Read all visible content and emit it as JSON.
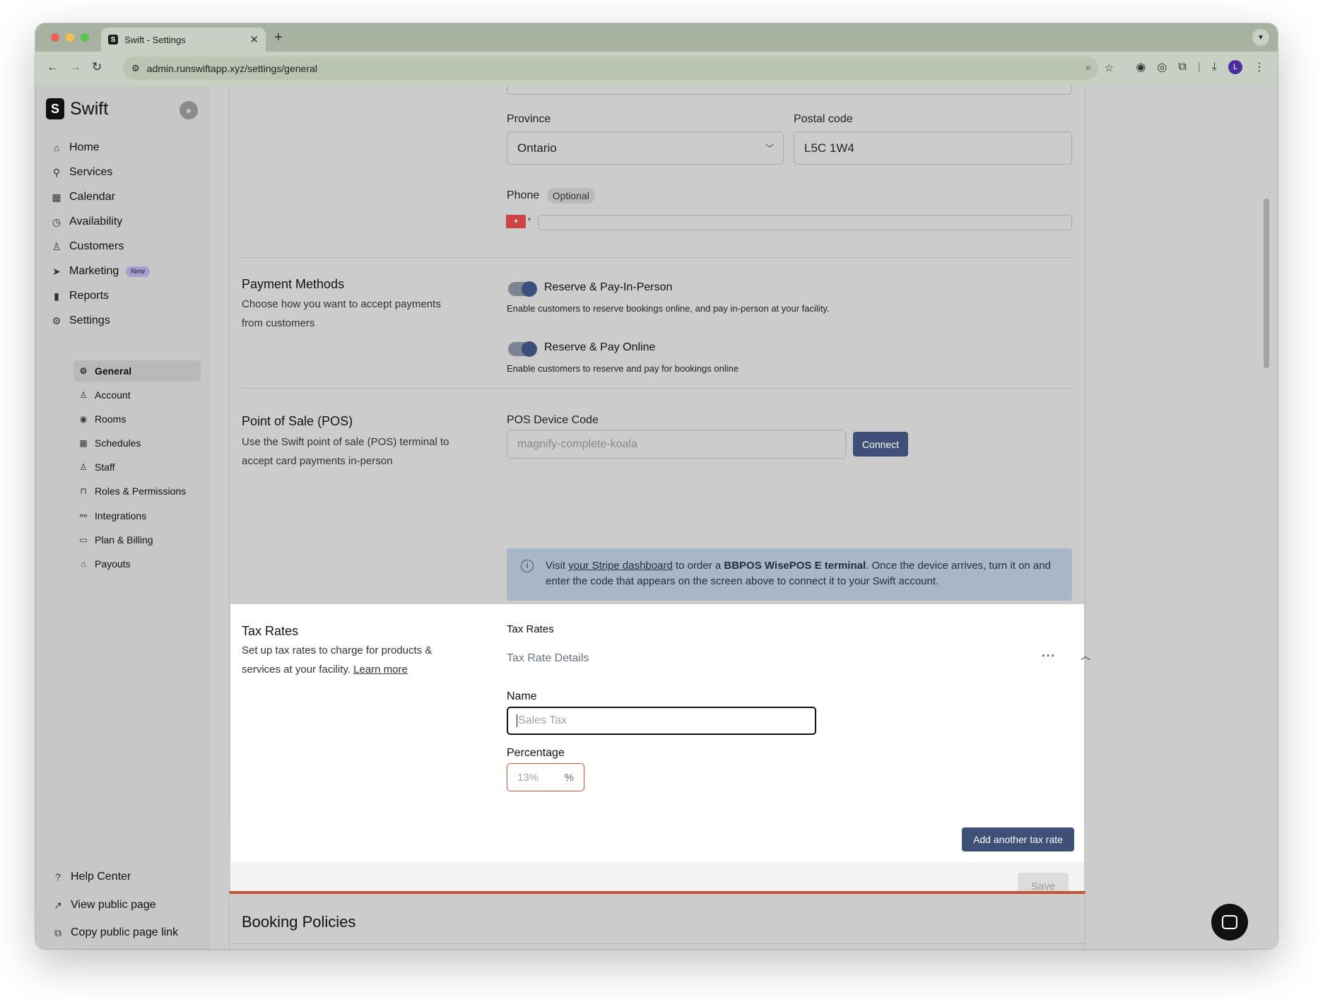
{
  "browser": {
    "tab_title": "Swift - Settings",
    "favicon": "S",
    "url": "admin.runswiftapp.xyz/settings/general",
    "profile_initial": "L"
  },
  "sidebar": {
    "brand": "Swift",
    "logo_letter": "S",
    "nav": [
      {
        "label": "Home",
        "icon": "home-icon"
      },
      {
        "label": "Services",
        "icon": "link-icon"
      },
      {
        "label": "Calendar",
        "icon": "calendar-icon"
      },
      {
        "label": "Availability",
        "icon": "clock-icon"
      },
      {
        "label": "Customers",
        "icon": "user-icon"
      },
      {
        "label": "Marketing",
        "icon": "send-icon",
        "badge": "New"
      },
      {
        "label": "Reports",
        "icon": "bar-chart-icon"
      },
      {
        "label": "Settings",
        "icon": "gear-icon"
      }
    ],
    "settings_sub": [
      {
        "label": "General",
        "icon": "gear-icon"
      },
      {
        "label": "Account",
        "icon": "user-icon"
      },
      {
        "label": "Rooms",
        "icon": "map-pin-icon"
      },
      {
        "label": "Schedules",
        "icon": "calendar-clock-icon"
      },
      {
        "label": "Staff",
        "icon": "users-icon"
      },
      {
        "label": "Roles & Permissions",
        "icon": "lock-icon"
      },
      {
        "label": "Integrations",
        "icon": "plug-icon"
      },
      {
        "label": "Plan & Billing",
        "icon": "credit-card-icon"
      },
      {
        "label": "Payouts",
        "icon": "bank-icon"
      }
    ],
    "footer": [
      {
        "label": "Help Center",
        "icon": "help-icon"
      },
      {
        "label": "View public page",
        "icon": "external-link-icon"
      },
      {
        "label": "Copy public page link",
        "icon": "copy-icon"
      }
    ]
  },
  "address": {
    "province_label": "Province",
    "province_value": "Ontario",
    "postal_label": "Postal code",
    "postal_value": "L5C 1W4",
    "phone_label": "Phone",
    "phone_optional": "Optional"
  },
  "payment": {
    "title": "Payment Methods",
    "description": "Choose how you want to accept payments from customers",
    "option1_label": "Reserve & Pay-In-Person",
    "option1_desc": "Enable customers to reserve bookings online, and pay in-person at your facility.",
    "option2_label": "Reserve & Pay Online",
    "option2_desc": "Enable customers to reserve and pay for bookings online"
  },
  "pos": {
    "title": "Point of Sale (POS)",
    "description": "Use the Swift point of sale (POS) terminal to accept card payments in-person",
    "code_label": "POS Device Code",
    "code_placeholder": "magnify-complete-koala",
    "connect_label": "Connect",
    "info_prefix": "Visit ",
    "info_link": "your Stripe dashboard",
    "info_mid": " to order a ",
    "info_bold": "BBPOS WisePOS E terminal",
    "info_suffix": ". Once the device arrives, turn it on and enter the code that appears on the screen above to connect it to your Swift account."
  },
  "tax": {
    "title": "Tax Rates",
    "description": "Set up tax rates to charge for products & services at your facility.",
    "learn_more": "Learn more",
    "header": "Tax Rates",
    "details_label": "Tax Rate Details",
    "name_label": "Name",
    "name_placeholder": "Sales Tax",
    "percentage_label": "Percentage",
    "percentage_placeholder": "13%",
    "percent_sign": "%",
    "add_label": "Add another tax rate",
    "save_label": "Save"
  },
  "policies": {
    "title": "Booking Policies"
  },
  "colors": {
    "accent": "#3e5078",
    "policies_border": "#c0553a",
    "percentage_error_border": "#c0553a"
  }
}
